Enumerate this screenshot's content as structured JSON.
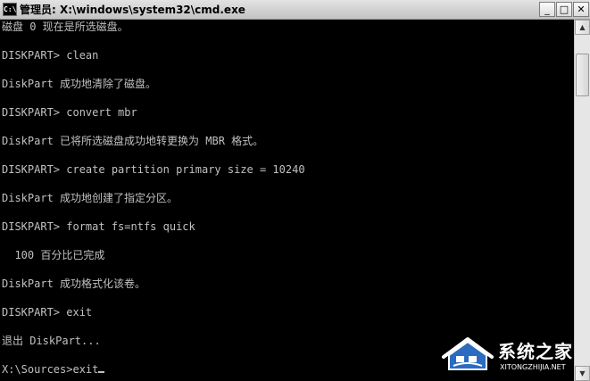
{
  "window": {
    "icon_text": "C:\\",
    "title": "管理员: X:\\windows\\system32\\cmd.exe",
    "controls": {
      "minimize": "_",
      "maximize": "□",
      "close": "✕"
    }
  },
  "console": {
    "lines": [
      "磁盘 0 现在是所选磁盘。",
      "",
      "DISKPART> clean",
      "",
      "DiskPart 成功地清除了磁盘。",
      "",
      "DISKPART> convert mbr",
      "",
      "DiskPart 已将所选磁盘成功地转更换为 MBR 格式。",
      "",
      "DISKPART> create partition primary size = 10240",
      "",
      "DiskPart 成功地创建了指定分区。",
      "",
      "DISKPART> format fs=ntfs quick",
      "",
      "  100 百分比已完成",
      "",
      "DiskPart 成功格式化该卷。",
      "",
      "DISKPART> exit",
      "",
      "退出 DiskPart...",
      "",
      "X:\\Sources>exit"
    ]
  },
  "scrollbar": {
    "up_arrow": "▲",
    "down_arrow": "▼"
  },
  "watermark": {
    "name_cn": "系统之家",
    "name_en": "XITONGZHIJIA.NET"
  },
  "colors": {
    "console_bg": "#000000",
    "console_fg": "#c0c0c0",
    "titlebar": "#d2d2d2"
  }
}
